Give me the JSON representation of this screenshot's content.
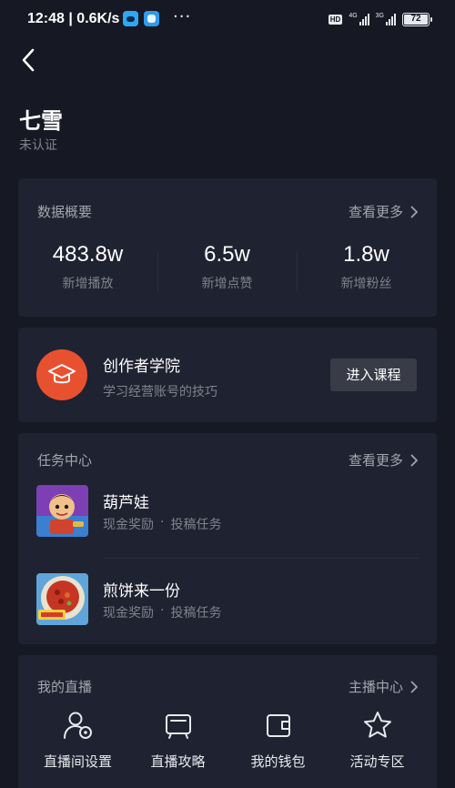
{
  "status_bar": {
    "time": "12:48",
    "speed": "0.6K/s",
    "dots": "···",
    "hd_label": "HD",
    "net1_label": "4G",
    "net2_label": "3G",
    "battery": "72"
  },
  "header": {
    "title": "七雪",
    "subtitle": "未认证"
  },
  "data_overview": {
    "heading": "数据概要",
    "more_label": "查看更多",
    "stats": [
      {
        "value": "483.8w",
        "label": "新增播放"
      },
      {
        "value": "6.5w",
        "label": "新增点赞"
      },
      {
        "value": "1.8w",
        "label": "新增粉丝"
      }
    ]
  },
  "academy": {
    "icon": "graduation-cap-icon",
    "name": "创作者学院",
    "desc": "学习经营账号的技巧",
    "button_label": "进入课程"
  },
  "task_center": {
    "heading": "任务中心",
    "more_label": "查看更多",
    "tasks": [
      {
        "name": "葫芦娃",
        "reward": "现金奖励",
        "sep": "·",
        "type": "投稿任务"
      },
      {
        "name": "煎饼来一份",
        "reward": "现金奖励",
        "sep": "·",
        "type": "投稿任务"
      }
    ]
  },
  "live": {
    "heading": "我的直播",
    "more_label": "主播中心",
    "items": [
      {
        "icon": "user-settings-icon",
        "label": "直播间设置"
      },
      {
        "icon": "tv-icon",
        "label": "直播攻略"
      },
      {
        "icon": "wallet-icon",
        "label": "我的钱包"
      },
      {
        "icon": "star-icon",
        "label": "活动专区"
      }
    ]
  },
  "colors": {
    "background": "#161823",
    "card": "#1f2230",
    "accent": "#e8512f",
    "secondary_text": "#80828c"
  }
}
